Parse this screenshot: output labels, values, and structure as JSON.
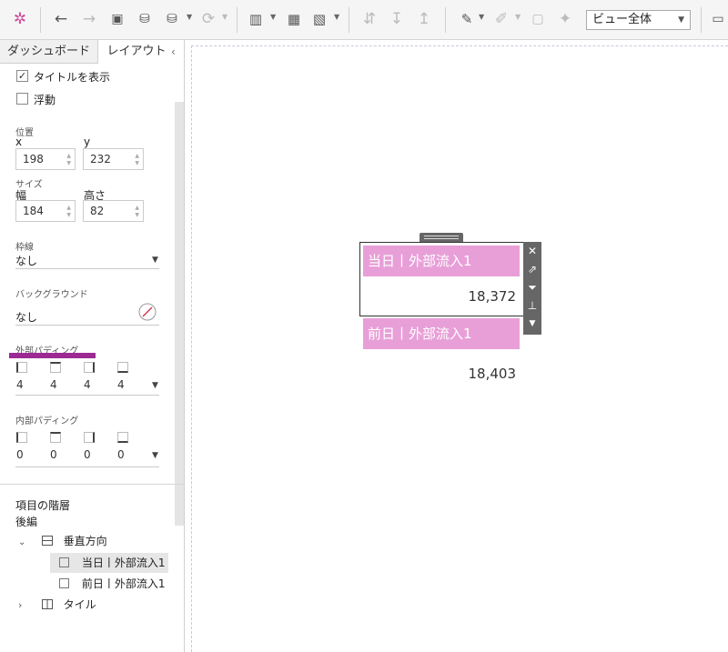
{
  "toolbar": {
    "view_select": "ビュー全体"
  },
  "panel": {
    "tabs": [
      "ダッシュボード",
      "レイアウト"
    ],
    "show_title_label": "タイトルを表示",
    "show_title_checked": "✓",
    "floating_label": "浮動",
    "position_label": "位置",
    "x_label": "x",
    "y_label": "y",
    "x_value": "198",
    "y_value": "232",
    "size_label": "サイズ",
    "width_label": "幅",
    "height_label": "高さ",
    "width_value": "184",
    "height_value": "82",
    "border_label": "枠線",
    "border_value": "なし",
    "background_label": "バックグラウンド",
    "background_value": "なし",
    "outer_padding_label": "外部パディング",
    "outer_padding_values": [
      "4",
      "4",
      "4",
      "4"
    ],
    "inner_padding_label": "内部パディング",
    "inner_padding_values": [
      "0",
      "0",
      "0",
      "0"
    ],
    "hierarchy_title": "項目の階層",
    "hierarchy_sub": "後編",
    "tree": {
      "vertical": "垂直方向",
      "item1": "当日丨外部流入1",
      "item2": "前日丨外部流入1",
      "tile": "タイル"
    }
  },
  "canvas": {
    "card1_title": "当日丨外部流入1",
    "card1_value": "18,372",
    "card2_title": "前日丨外部流入1",
    "card2_value": "18,403"
  },
  "colors": {
    "card_title_bg": "#e89fd8",
    "highlight_bar": "#9b2a93"
  }
}
